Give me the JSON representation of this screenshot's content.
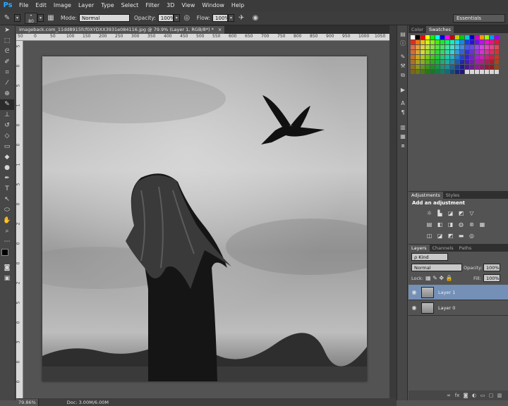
{
  "app": {
    "logo": "Ps"
  },
  "menu": [
    "File",
    "Edit",
    "Image",
    "Layer",
    "Type",
    "Select",
    "Filter",
    "3D",
    "View",
    "Window",
    "Help"
  ],
  "options": {
    "brush_size": "80",
    "mode_label": "Mode:",
    "mode_value": "Normal",
    "opacity_label": "Opacity:",
    "opacity_value": "100%",
    "flow_label": "Flow:",
    "flow_value": "100%",
    "workspace": "Essentials"
  },
  "document": {
    "tab_title": "imageback.com_11dd8915fcf0XYDXX3931e084116.jpg @ 79.9% (Layer 1, RGB/8*) *",
    "close_glyph": "×",
    "ruler_h": [
      "50",
      "0",
      "50",
      "100",
      "150",
      "200",
      "250",
      "300",
      "350",
      "400",
      "450",
      "500",
      "550",
      "600",
      "650",
      "700",
      "750",
      "800",
      "850",
      "900",
      "950",
      "1000",
      "1050"
    ],
    "ruler_v": [
      "5",
      "0",
      "5",
      "1",
      "0",
      "0",
      "1",
      "5",
      "0",
      "2",
      "0",
      "0",
      "2",
      "5",
      "0",
      "3",
      "0",
      "0"
    ]
  },
  "status": {
    "zoom": "79.86%",
    "doc": "Doc: 3.00M/6.00M"
  },
  "panels": {
    "color_tabs": [
      "Color",
      "Swatches"
    ],
    "adjust_tabs": [
      "Adjustments",
      "Styles"
    ],
    "adjust_title": "Add an adjustment",
    "layers_tabs": [
      "Layers",
      "Channels",
      "Paths"
    ],
    "kind": "ρ Kind",
    "blend": "Normal",
    "opacity_label": "Opacity:",
    "opacity_value": "100%",
    "lock_label": "Lock:",
    "fill_label": "Fill:",
    "fill_value": "100%",
    "layers": [
      {
        "name": "Layer 1",
        "selected": true
      },
      {
        "name": "Layer 0",
        "selected": false
      }
    ]
  },
  "colors": {
    "accent": "#31a8ff",
    "selected_layer": "#7590b7"
  }
}
